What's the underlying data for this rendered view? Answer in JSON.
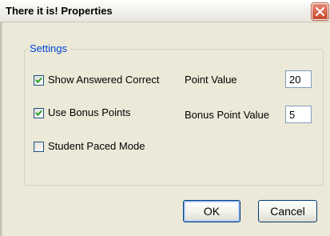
{
  "window": {
    "title": "There it is! Properties",
    "close_icon": "close-x-icon"
  },
  "settings_group": {
    "legend": "Settings",
    "show_answered_correct": {
      "label": "Show Answered Correct",
      "checked": true
    },
    "use_bonus_points": {
      "label": "Use Bonus Points",
      "checked": true
    },
    "student_paced_mode": {
      "label": "Student Paced Mode",
      "checked": false
    },
    "point_value": {
      "label": "Point Value",
      "value": "20"
    },
    "bonus_point_value": {
      "label": "Bonus Point Value",
      "value": "5"
    }
  },
  "buttons": {
    "ok_label": "OK",
    "cancel_label": "Cancel"
  },
  "colors": {
    "legend_blue": "#0046d5",
    "window_face": "#ece9d8",
    "checkmark_green": "#21a121"
  }
}
